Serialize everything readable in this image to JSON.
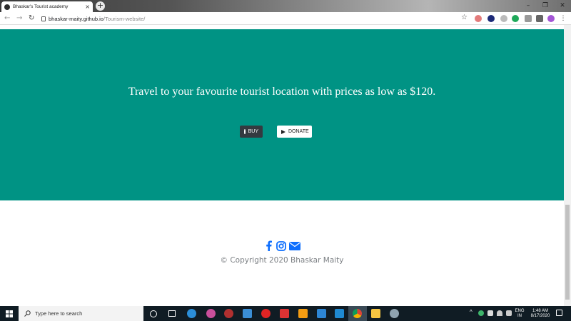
{
  "browser": {
    "tab_title": "Bhaskar's Tourist academy",
    "tab_close": "×",
    "new_tab": "+",
    "url_host": "bhaskar-maity.github.io",
    "url_path": "/Tourism-website/",
    "window_controls": [
      "–",
      "❐",
      "✕"
    ]
  },
  "hero": {
    "headline": "Travel to your favourite tourist location with prices as low as $120.",
    "buy_label": "BUY",
    "donate_label": "DONATE",
    "background": "#009384"
  },
  "footer": {
    "copyright": "© Copyright 2020 Bhaskar Maity",
    "icon_color": "#0d6efd"
  },
  "taskbar": {
    "search_placeholder": "Type here to search",
    "lang_top": "ENG",
    "lang_bottom": "IN",
    "time": "1:48 AM",
    "date": "8/17/2020"
  }
}
